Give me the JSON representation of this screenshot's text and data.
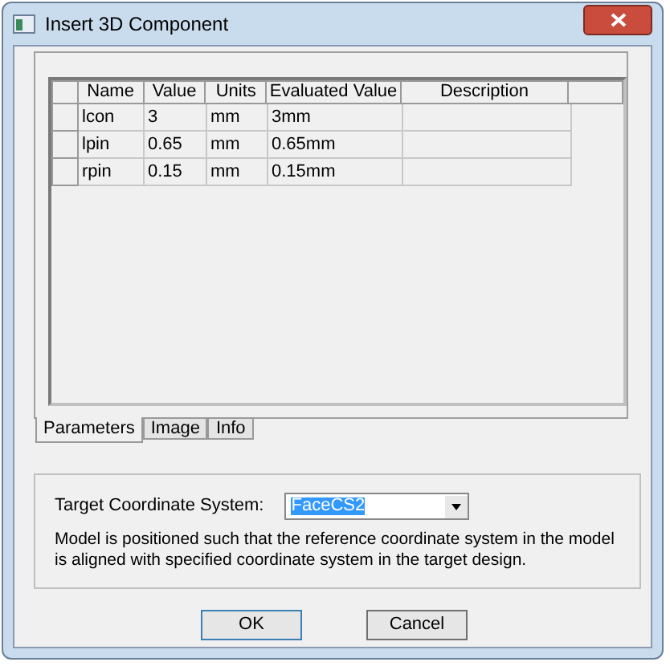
{
  "window": {
    "title": "Insert 3D Component"
  },
  "table": {
    "columns": [
      "Name",
      "Value",
      "Units",
      "Evaluated Value",
      "Description"
    ],
    "rows": [
      {
        "cells": [
          "lcon",
          "3",
          "mm",
          "3mm",
          ""
        ]
      },
      {
        "cells": [
          "lpin",
          "0.65",
          "mm",
          "0.65mm",
          ""
        ]
      },
      {
        "cells": [
          "rpin",
          "0.15",
          "mm",
          "0.15mm",
          ""
        ]
      }
    ]
  },
  "tabs": [
    {
      "label": "Parameters",
      "selected": true
    },
    {
      "label": "Image",
      "selected": false
    },
    {
      "label": "Info",
      "selected": false
    }
  ],
  "target": {
    "label": "Target Coordinate System:",
    "value": "FaceCS2",
    "note": "Model is positioned such that the reference coordinate system in the model is aligned with specified coordinate system in the target design."
  },
  "buttons": [
    "OK",
    "Cancel"
  ]
}
